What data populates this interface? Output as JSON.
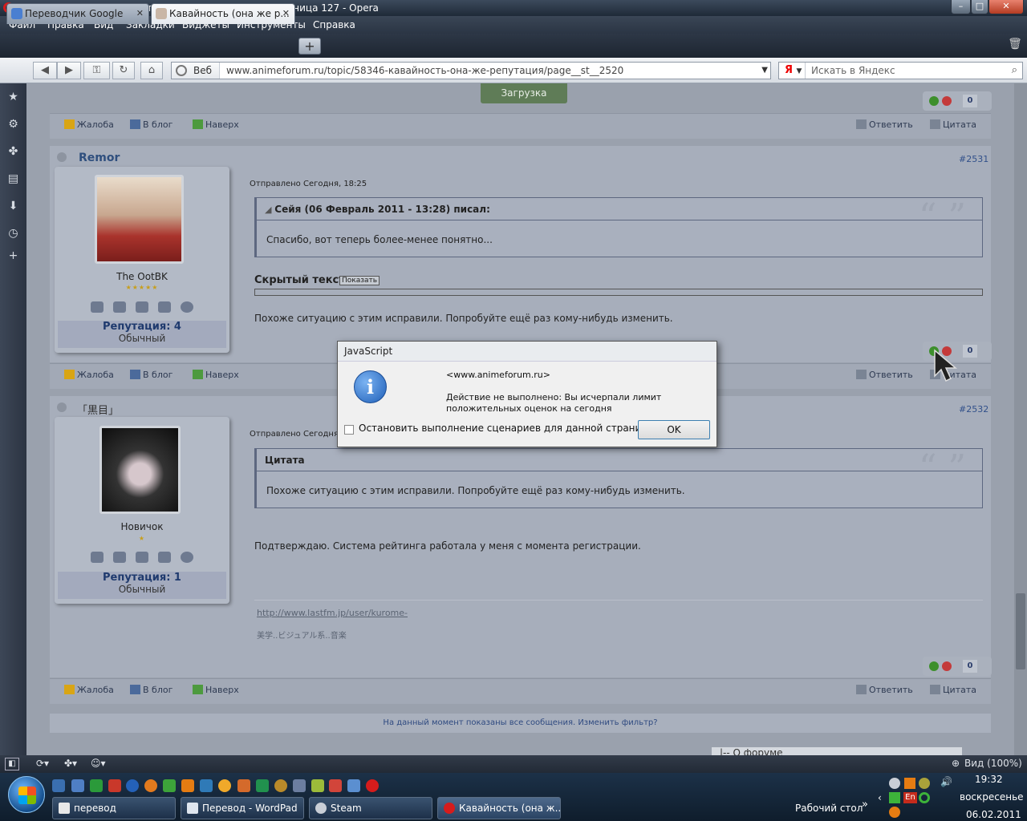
{
  "window": {
    "title": "Кавайность (она же репутация) - Аниме-Форум - Страница 127 - Opera"
  },
  "menu": [
    "Файл",
    "Правка",
    "Вид",
    "Закладки",
    "Виджеты",
    "Инструменты",
    "Справка"
  ],
  "tabs": [
    {
      "label": "Переводчик Google",
      "active": false
    },
    {
      "label": "Кавайность (она же р...",
      "active": true
    }
  ],
  "nav": {
    "web_label": "Веб",
    "url": "www.animeforum.ru/topic/58346-кавайность-она-же-репутация/page__st__2520",
    "search_engine": "Я",
    "search_placeholder": "Искать в Яндекс"
  },
  "top": {
    "load_button": "Загрузка",
    "vote_count": "0"
  },
  "post_actions": {
    "report": "Жалоба",
    "blog": "В блог",
    "up": "Наверх",
    "reply": "Ответить",
    "quote": "Цитата"
  },
  "posts": [
    {
      "author": "Remor",
      "number": "#2531",
      "rank": "The OotBK",
      "stars": "★★★★★",
      "reputation": "Репутация: 4",
      "rep_status": "Обычный",
      "sent": "Отправлено Сегодня, 18:25",
      "quote_header": "Сейя (06 Февраль 2011 - 13:28) писал:",
      "quote_text": "Спасибо, вот теперь более-менее понятно...",
      "hidden_label": "Скрытый текст",
      "hidden_button": "Показать",
      "text": "Похоже ситуацию с этим исправили. Попробуйте ещё раз кому-нибудь изменить.",
      "votes": "0"
    },
    {
      "author": "「黒目」",
      "number": "#2532",
      "rank": "Новичок",
      "stars": "★",
      "reputation": "Репутация: 1",
      "rep_status": "Обычный",
      "sent": "Отправлено Сегодня, ",
      "quote_header": "Цитата",
      "quote_text": "Похоже ситуацию с этим исправили. Попробуйте ещё раз кому-нибудь изменить.",
      "text": "Подтверждаю. Система рейтинга работала у меня с момента регистрации.",
      "signature_link": "http://www.lastfm.jp/user/kurome-",
      "signature_text": "美学..ビジュアル系..音楽",
      "votes": "0"
    }
  ],
  "filter_text": "На данный момент показаны все сообщения. Изменить фильтр?",
  "about_select": "|-- О форуме",
  "dialog": {
    "title": "JavaScript",
    "site": "<www.animeforum.ru>",
    "message": "Действие не выполнено: Вы исчерпали лимит положительных оценок на сегодня",
    "checkbox_label": "Остановить выполнение сценариев для данной страницы",
    "ok": "OK"
  },
  "status": {
    "zoom": "Вид (100%)"
  },
  "taskbar": {
    "buttons": [
      "перевод",
      "Перевод - WordPad",
      "Steam",
      "Кавайность (она ж..."
    ],
    "desktop_label": "Рабочий стол",
    "lang": "En",
    "time": "19:32",
    "day": "воскресенье",
    "date": "06.02.2011"
  },
  "colors": {
    "accent_link": "#2f4f7e",
    "menu_bg": "#2b3544",
    "opera_red": "#d61c1c"
  }
}
